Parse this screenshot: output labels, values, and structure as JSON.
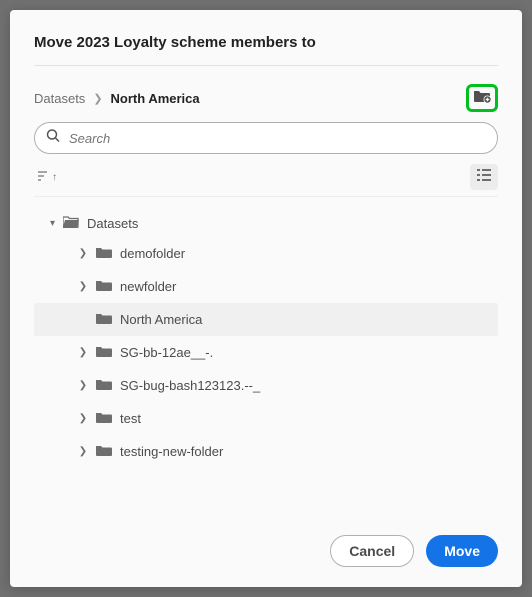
{
  "title": "Move 2023 Loyalty scheme members to",
  "breadcrumb": {
    "root": "Datasets",
    "current": "North America"
  },
  "search": {
    "placeholder": "Search"
  },
  "tree": {
    "root": "Datasets",
    "items": [
      {
        "label": "demofolder",
        "expandable": true,
        "selected": false
      },
      {
        "label": "newfolder",
        "expandable": true,
        "selected": false
      },
      {
        "label": "North America",
        "expandable": false,
        "selected": true
      },
      {
        "label": "SG-bb-12ae__-.",
        "expandable": true,
        "selected": false
      },
      {
        "label": "SG-bug-bash123123.--_",
        "expandable": true,
        "selected": false
      },
      {
        "label": "test",
        "expandable": true,
        "selected": false
      },
      {
        "label": "testing-new-folder",
        "expandable": true,
        "selected": false
      }
    ]
  },
  "buttons": {
    "cancel": "Cancel",
    "move": "Move"
  }
}
